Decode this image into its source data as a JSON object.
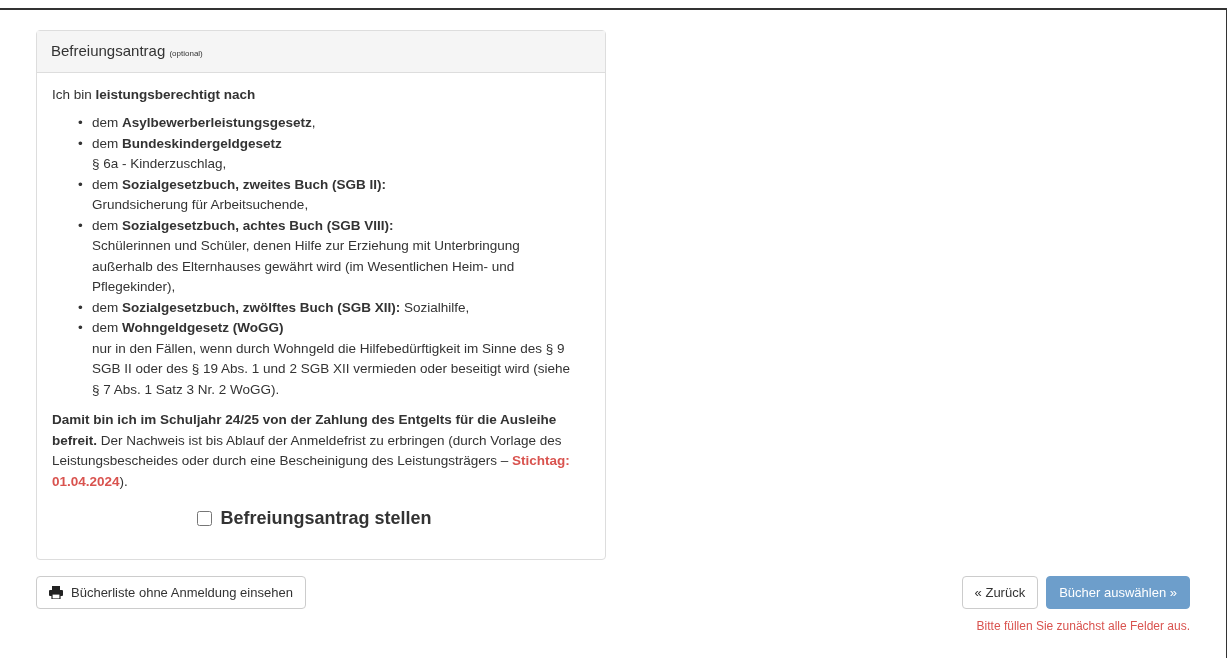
{
  "panel": {
    "title": "Befreiungsantrag",
    "subtitle": "(optional)",
    "intro": "Ich bin **leistungsberechtigt nach**",
    "items": [
      {
        "marker": "•",
        "lead": "dem **Asylbewerberleistungsgesetz**,"
      },
      {
        "marker": "•",
        "lead": "dem **Bundeskindergeldgesetz**",
        "detail": "§ 6a - Kinderzuschlag,"
      },
      {
        "marker": "•",
        "lead": "dem **Sozialgesetzbuch, zweites Buch (SGB II):**",
        "detail": "Grundsicherung für Arbeitsuchende,"
      },
      {
        "marker": "•",
        "lead": "dem **Sozialgesetzbuch, achtes Buch (SGB VIII):**",
        "detail": "Schülerinnen und Schüler, denen Hilfe zur Erziehung mit Unterbringung außerhalb des Elternhauses gewährt wird (im Wesentlichen Heim- und Pflegekinder),"
      },
      {
        "marker": "•",
        "lead": "dem **Sozialgesetzbuch, zwölftes Buch (SGB XII):** Sozialhilfe,"
      },
      {
        "marker": "•",
        "lead": "dem **Wohngeldgesetz (WoGG)**",
        "detail": "nur in den Fällen, wenn durch Wohngeld die Hilfebedürftigkeit im Sinne des § 9 SGB II oder des § 19 Abs. 1 und 2 SGB XII vermieden oder beseitigt wird (siehe § 7 Abs. 1 Satz 3 Nr. 2 WoGG)."
      }
    ],
    "closing": "**Damit bin ich im Schuljahr 24/25 von der Zahlung des Entgelts für die Ausleihe befreit.** Der Nachweis ist bis Ablauf der Anmeldefrist zu erbringen (durch Vorlage des Leistungsbescheides oder durch eine Bescheinigung des Leistungsträgers – ",
    "deadline": "Stichtag: 01.04.2024",
    "closing_end": ").",
    "checkbox": {
      "label": "Befreiungsantrag stellen",
      "checked": false
    }
  },
  "print_button": {
    "label": "Bücherliste ohne Anmeldung einsehen"
  },
  "back_button": {
    "label": "« Zurück"
  },
  "next_button": {
    "label": "Bücher auswählen »",
    "disabled": true
  },
  "error_message": "Bitte füllen Sie zunächst alle Felder aus."
}
